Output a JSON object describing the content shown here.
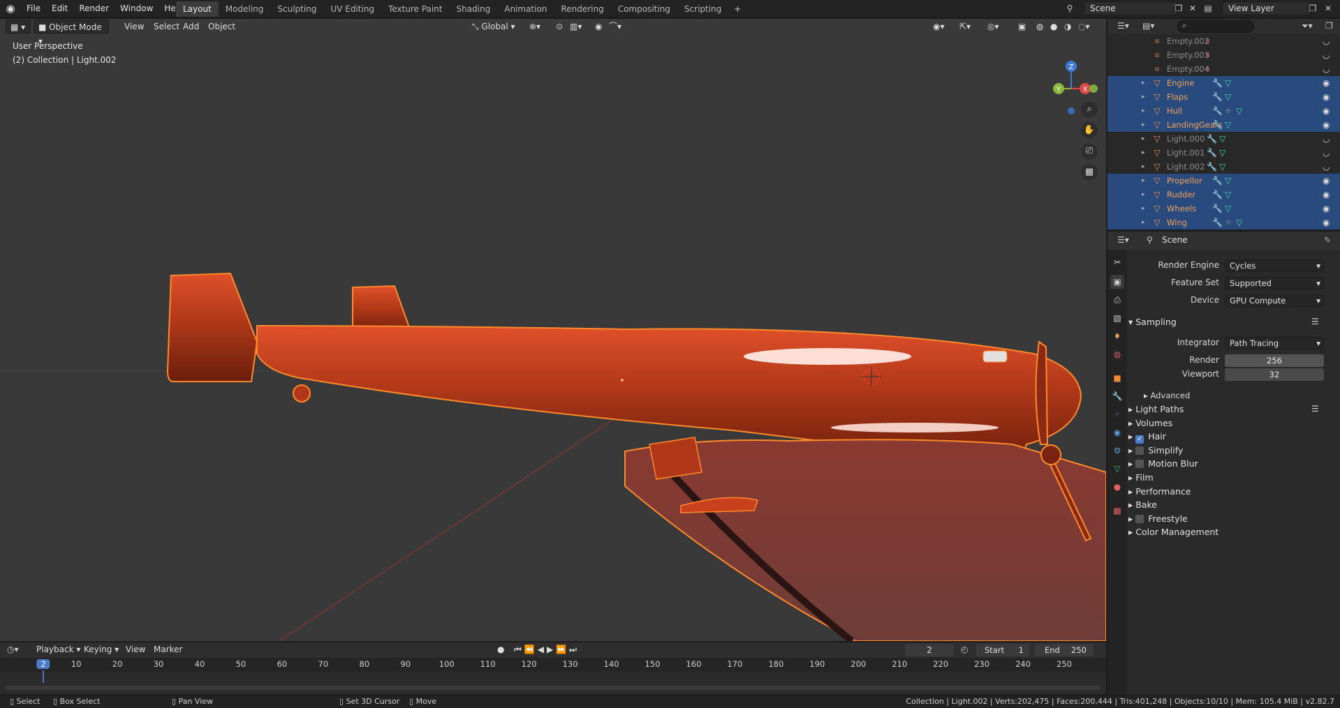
{
  "app": {
    "menus": [
      "File",
      "Edit",
      "Render",
      "Window",
      "Help"
    ]
  },
  "workspaces": {
    "tabs": [
      "Layout",
      "Modeling",
      "Sculpting",
      "UV Editing",
      "Texture Paint",
      "Shading",
      "Animation",
      "Rendering",
      "Compositing",
      "Scripting"
    ],
    "active": "Layout",
    "add_label": "+"
  },
  "scene": {
    "name": "Scene"
  },
  "view_layer": {
    "name": "View Layer"
  },
  "viewport": {
    "mode": "Object Mode",
    "menus": [
      "View",
      "Select",
      "Add",
      "Object"
    ],
    "transform_orientation": "Global",
    "perspective_label": "User Perspective",
    "collection_label": "(2) Collection | Light.002",
    "gizmo_axes": {
      "z": "Z",
      "x": "X",
      "y": "Y"
    }
  },
  "outliner": {
    "search_placeholder": "",
    "rows": [
      {
        "name": "Empty.002",
        "selected": false,
        "dim": true
      },
      {
        "name": "Empty.003",
        "selected": false,
        "dim": true
      },
      {
        "name": "Empty.004",
        "selected": false,
        "dim": true
      },
      {
        "name": "Engine",
        "selected": true,
        "dim": false
      },
      {
        "name": "Flaps",
        "selected": true,
        "dim": false
      },
      {
        "name": "Hull",
        "selected": true,
        "dim": false
      },
      {
        "name": "LandingGears",
        "selected": true,
        "dim": false
      },
      {
        "name": "Light.000",
        "selected": false,
        "dim": true
      },
      {
        "name": "Light.001",
        "selected": false,
        "dim": true
      },
      {
        "name": "Light.002",
        "selected": false,
        "dim": true
      },
      {
        "name": "Propellor",
        "selected": true,
        "dim": false
      },
      {
        "name": "Rudder",
        "selected": true,
        "dim": false
      },
      {
        "name": "Wheels",
        "selected": true,
        "dim": false
      },
      {
        "name": "Wing",
        "selected": true,
        "dim": false
      }
    ]
  },
  "properties": {
    "context": "Scene",
    "render_engine_label": "Render Engine",
    "render_engine": "Cycles",
    "feature_set_label": "Feature Set",
    "feature_set": "Supported",
    "device_label": "Device",
    "device": "GPU Compute",
    "sampling_label": "Sampling",
    "integrator_label": "Integrator",
    "integrator": "Path Tracing",
    "render_label": "Render",
    "render_samples": "256",
    "viewport_label": "Viewport",
    "viewport_samples": "32",
    "advanced_label": "Advanced",
    "sections": [
      {
        "label": "Light Paths",
        "checkbox": null
      },
      {
        "label": "Volumes",
        "checkbox": null
      },
      {
        "label": "Hair",
        "checkbox": true
      },
      {
        "label": "Simplify",
        "checkbox": false
      },
      {
        "label": "Motion Blur",
        "checkbox": false
      },
      {
        "label": "Film",
        "checkbox": null
      },
      {
        "label": "Performance",
        "checkbox": null
      },
      {
        "label": "Bake",
        "checkbox": null
      },
      {
        "label": "Freestyle",
        "checkbox": false
      },
      {
        "label": "Color Management",
        "checkbox": null
      }
    ]
  },
  "timeline": {
    "menus": [
      "Playback",
      "Keying",
      "View",
      "Marker"
    ],
    "current_frame": "2",
    "start_label": "Start",
    "start": "1",
    "end_label": "End",
    "end": "250",
    "ticks": [
      "2",
      "10",
      "20",
      "30",
      "40",
      "50",
      "60",
      "70",
      "80",
      "90",
      "100",
      "110",
      "120",
      "130",
      "140",
      "150",
      "160",
      "170",
      "180",
      "190",
      "200",
      "210",
      "220",
      "230",
      "240",
      "250"
    ]
  },
  "statusbar": {
    "select": "Select",
    "box_select": "Box Select",
    "pan_view": "Pan View",
    "set_cursor": "Set 3D Cursor",
    "move": "Move",
    "stats": "Collection | Light.002 | Verts:202,475 | Faces:200,444 | Tris:401,248 | Objects:10/10 | Mem: 105.4 MiB | v2.82.7"
  },
  "colors": {
    "accent": "#4a7cc9",
    "selection_bg": "#284a7c",
    "object_orange": "#f2a25a",
    "mesh_red": "#b8381c"
  }
}
